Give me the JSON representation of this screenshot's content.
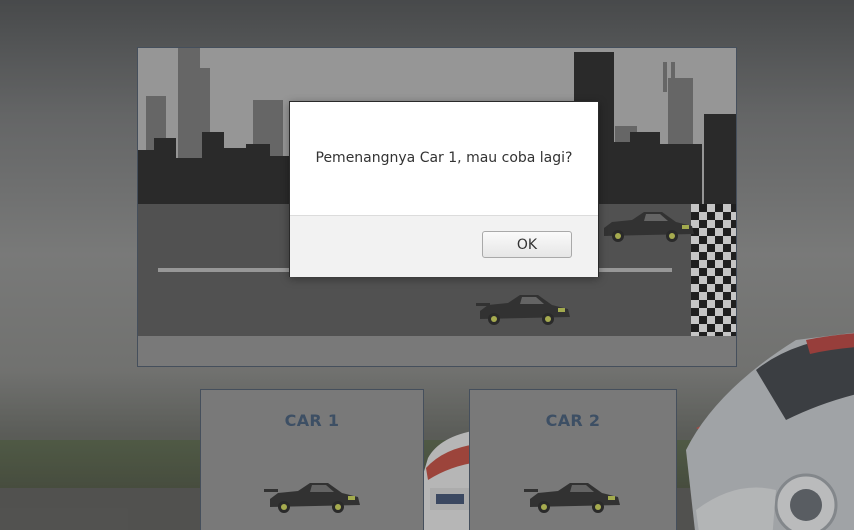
{
  "game": {
    "finish_flag": "checkered-flag",
    "cars_on_track": [
      "car-1",
      "car-2"
    ]
  },
  "panels": [
    {
      "title": "CAR 1",
      "icon": "race-car-icon"
    },
    {
      "title": "CAR 2",
      "icon": "race-car-icon"
    }
  ],
  "dialog": {
    "message": "Pemenangnya Car 1, mau coba lagi?",
    "ok_label": "OK"
  },
  "colors": {
    "panel_title": "#2f4a6b",
    "panel_border": "#3b4b5e",
    "track": "#4d4d4d",
    "skyline": "#0d0d0d"
  }
}
